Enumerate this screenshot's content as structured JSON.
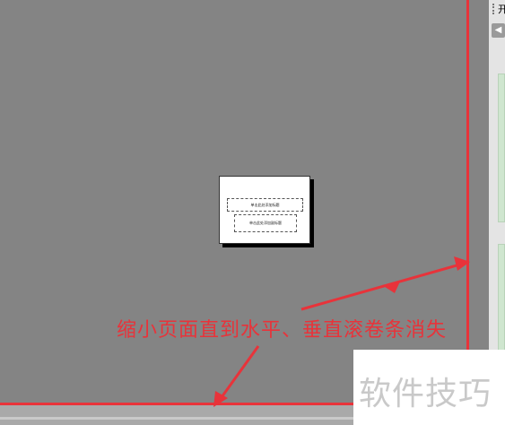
{
  "slide": {
    "title_placeholder": "单击此处添加标题",
    "subtitle_placeholder": "单击此处添加副标题"
  },
  "task_pane": {
    "title_glyph": "开",
    "button_icon": "back-arrow-icon"
  },
  "annotation": {
    "text": "缩小页面直到水平、垂直滚卷条消失",
    "color": "#e8333a"
  },
  "watermark": {
    "text": "软件技巧"
  },
  "colors": {
    "canvas": "#848484",
    "highlight": "#e8333a",
    "pane_green": "#cfe6cf"
  }
}
